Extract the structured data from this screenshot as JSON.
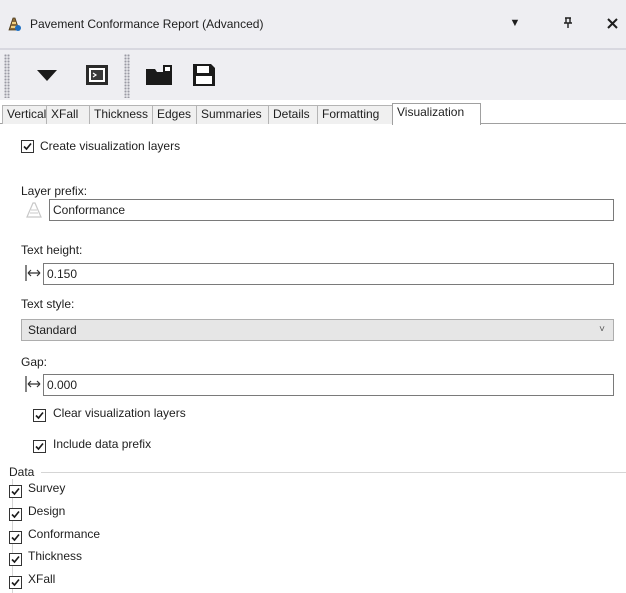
{
  "window": {
    "title": "Pavement Conformance Report (Advanced)",
    "dropdown_glyph": "▼",
    "pin_glyph": "ᚁ",
    "close_glyph": "✕"
  },
  "toolbar": {
    "icons": [
      "dropdown-triangle-icon",
      "console-icon",
      "open-folder-icon",
      "save-disk-icon"
    ]
  },
  "tabs": [
    "Vertical",
    "XFall",
    "Thickness",
    "Edges",
    "Summaries",
    "Details",
    "Formatting",
    "Visualization"
  ],
  "active_tab": "Visualization",
  "visualization": {
    "create_layers_label": "Create visualization layers",
    "layer_prefix_label": "Layer prefix:",
    "layer_prefix_value": "Conformance",
    "text_height_label": "Text height:",
    "text_height_value": "0.150",
    "text_style_label": "Text style:",
    "text_style_value": "Standard",
    "gap_label": "Gap:",
    "gap_value": "0.000",
    "clear_layers_label": "Clear visualization layers",
    "include_prefix_label": "Include data prefix"
  },
  "data_group": {
    "title": "Data",
    "items": [
      "Survey",
      "Design",
      "Conformance",
      "Thickness",
      "XFall"
    ]
  },
  "colors": {
    "titlebar_bg": "#eeeef2",
    "accent_blue": "#1e6fc1"
  }
}
